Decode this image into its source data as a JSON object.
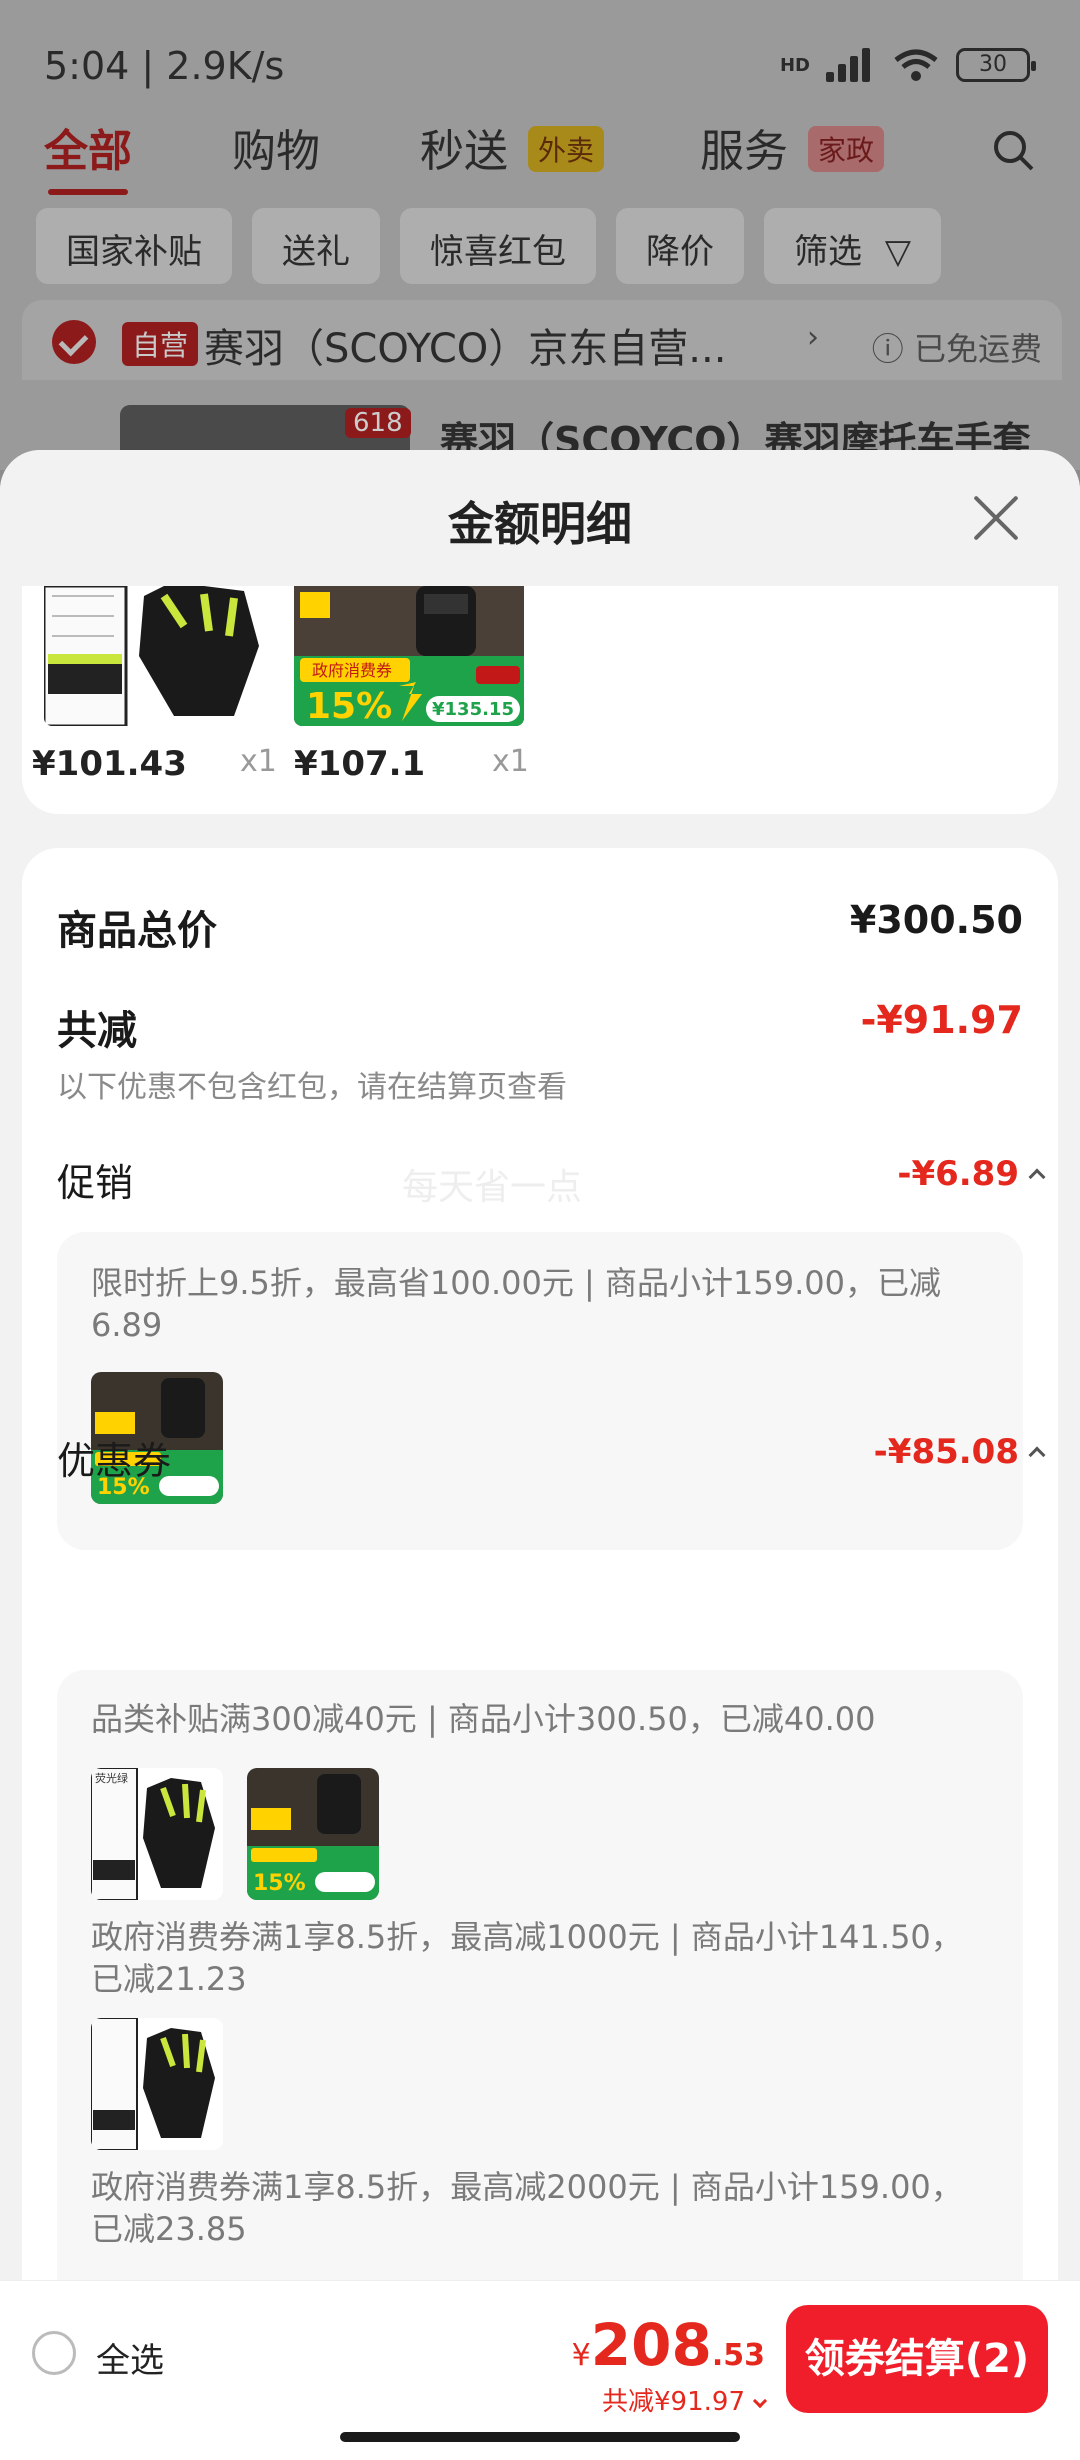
{
  "status_bar": {
    "time": "5:04 | 2.9K/s",
    "battery": "30",
    "network": "HD"
  },
  "top_tabs": [
    {
      "label": "全部"
    },
    {
      "label": "购物"
    },
    {
      "label": "秒送",
      "badge": "外卖"
    },
    {
      "label": "服务",
      "badge": "家政"
    }
  ],
  "filters": [
    "国家补贴",
    "送礼",
    "惊喜红包",
    "降价",
    "筛选"
  ],
  "store": {
    "badge": "自营",
    "name": "赛羽（SCOYCO）京东自营...",
    "shipping": "已免运费",
    "product_tag": "618",
    "product_title": "赛羽（SCOYCO）赛羽摩托车手套"
  },
  "sheet": {
    "title": "金额明细",
    "items": [
      {
        "price": "¥101.43",
        "qty": "x1"
      },
      {
        "price": "¥107.1",
        "qty": "x1"
      }
    ],
    "total_label": "商品总价",
    "total_value": "¥300.50",
    "discount_label": "共减",
    "discount_value": "-¥91.97",
    "discount_note": "以下优惠不包含红包，请在结算页查看",
    "watermark": "每天省一点",
    "promo": {
      "label": "促销",
      "value": "-¥6.89",
      "desc": "限时折上9.5折，最高省100.00元 | 商品小计159.00，已减6.89"
    },
    "coupon": {
      "label": "优惠券",
      "value": "-¥85.08",
      "entries": [
        "品类补贴满300减40元 | 商品小计300.50，已减40.00",
        "政府消费券满1享8.5折，最高减1000元 | 商品小计141.50，已减21.23",
        "政府消费券满1享8.5折，最高减2000元 | 商品小计159.00，已减23.85"
      ]
    },
    "image_text": {
      "pump_pct": "15%",
      "pump_price": "¥135.15",
      "pump_banner": "政府消费券",
      "glove_label": "荧光绿"
    }
  },
  "bottom": {
    "select_all": "全选",
    "currency": "¥",
    "total_int": "208",
    "total_dec": ".53",
    "total_discount": "共减¥91.97",
    "checkout": "领券结算(2)"
  },
  "colors": {
    "accent_red": "#e4281e",
    "button_red": "#f01e2a"
  }
}
